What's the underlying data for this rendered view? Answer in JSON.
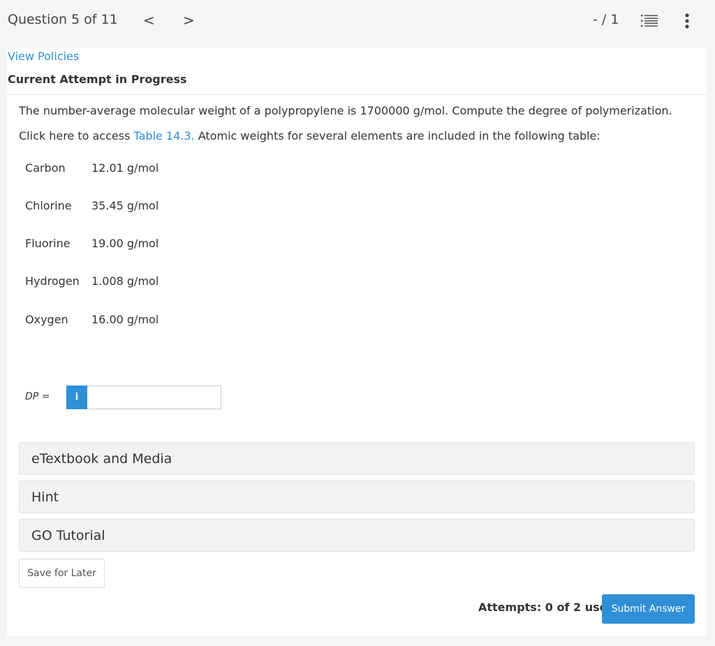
{
  "header": {
    "question_label": "Question 5 of 11",
    "prev_glyph": "<",
    "next_glyph": ">",
    "score": "- / 1",
    "icons": [
      "list-icon",
      "more-vertical-icon"
    ]
  },
  "policies_link": "View Policies",
  "attempt_heading": "Current Attempt in Progress",
  "problem_text": "The number-average molecular weight of a polypropylene is 1700000 g/mol. Compute the degree of polymerization.",
  "access": {
    "prefix": "Click here to access ",
    "link": "Table 14.3.",
    "suffix": " Atomic weights for several elements are included in the following table:"
  },
  "atomic_weights": [
    {
      "element": "Carbon",
      "weight": "12.01 g/mol"
    },
    {
      "element": "Chlorine",
      "weight": "35.45 g/mol"
    },
    {
      "element": "Fluorine",
      "weight": "19.00 g/mol"
    },
    {
      "element": "Hydrogen",
      "weight": "1.008 g/mol"
    },
    {
      "element": "Oxygen",
      "weight": "16.00 g/mol"
    }
  ],
  "answer": {
    "label": "DP =",
    "info_glyph": "i",
    "value": "",
    "info_color": "#2f8fd8"
  },
  "sections": [
    {
      "label": "eTextbook and Media"
    },
    {
      "label": "Hint"
    },
    {
      "label": "GO Tutorial"
    }
  ],
  "save_label": "Save for Later",
  "attempts_text": "Attempts: 0 of 2 used",
  "submit_label": "Submit Answer",
  "colors": {
    "accent": "#2f8fd8",
    "text": "#333333",
    "background": "#f5f5f5"
  }
}
